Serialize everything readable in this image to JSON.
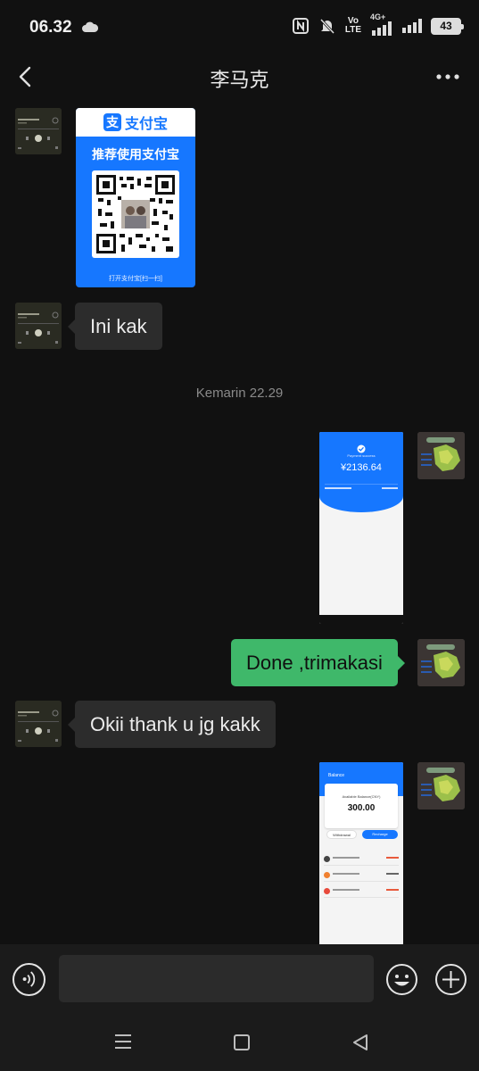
{
  "status_bar": {
    "time": "06.32",
    "network": "4G+",
    "volte_top": "Vo",
    "volte_bottom": "LTE",
    "battery": "43"
  },
  "header": {
    "title": "李马克"
  },
  "messages": {
    "alipay_card": {
      "logo": "支",
      "brand": "支付宝",
      "slogan": "推荐使用支付宝",
      "caption": "打开支付宝[扫一扫]"
    },
    "msg_ini_kak": "Ini kak",
    "timestamp": "Kemarin 22.29",
    "screenshot_payment": {
      "status": "Payment success",
      "amount": "¥2136.64"
    },
    "msg_done": "Done ,trimakasi",
    "msg_okii": "Okii thank u jg kakk",
    "screenshot_balance": {
      "title": "Balance",
      "label": "Available Balance(CNY)",
      "value": "300.00",
      "withdraw": "Withdrawal",
      "recharge": "Recharge"
    }
  },
  "input": {
    "placeholder": ""
  },
  "colors": {
    "sent_bubble": "#3fb86a",
    "received_bubble": "#2c2c2c",
    "alipay_blue": "#1677ff"
  }
}
